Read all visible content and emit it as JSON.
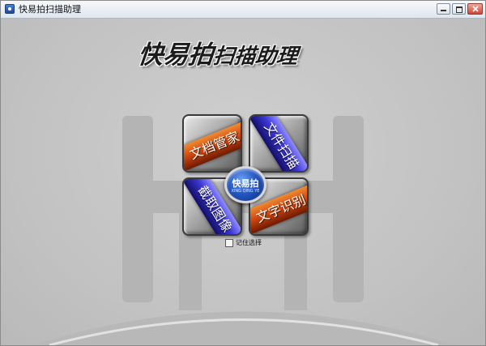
{
  "window": {
    "title": "快易拍扫描助理",
    "colors": {
      "titlebar": "#e6ebf2",
      "background": "#c2c2c2",
      "close": "#cf4636"
    }
  },
  "headline": {
    "part1": "快易拍",
    "part2": "扫描助理"
  },
  "launcher": {
    "tiles": [
      {
        "label": "文档管家",
        "band_color": "#d24a10"
      },
      {
        "label": "文件扫描",
        "band_color": "#3b36d6"
      },
      {
        "label": "截取图像",
        "band_color": "#3b36d6"
      },
      {
        "label": "文字识别",
        "band_color": "#d24a10"
      }
    ],
    "center": {
      "name": "快易拍",
      "sub": "XING QING YE"
    }
  },
  "remember": {
    "label": "记住选择",
    "checked": false
  },
  "icons": {
    "app": "app-icon",
    "minimize": "minimize-icon",
    "maximize": "maximize-icon",
    "close": "close-icon"
  }
}
